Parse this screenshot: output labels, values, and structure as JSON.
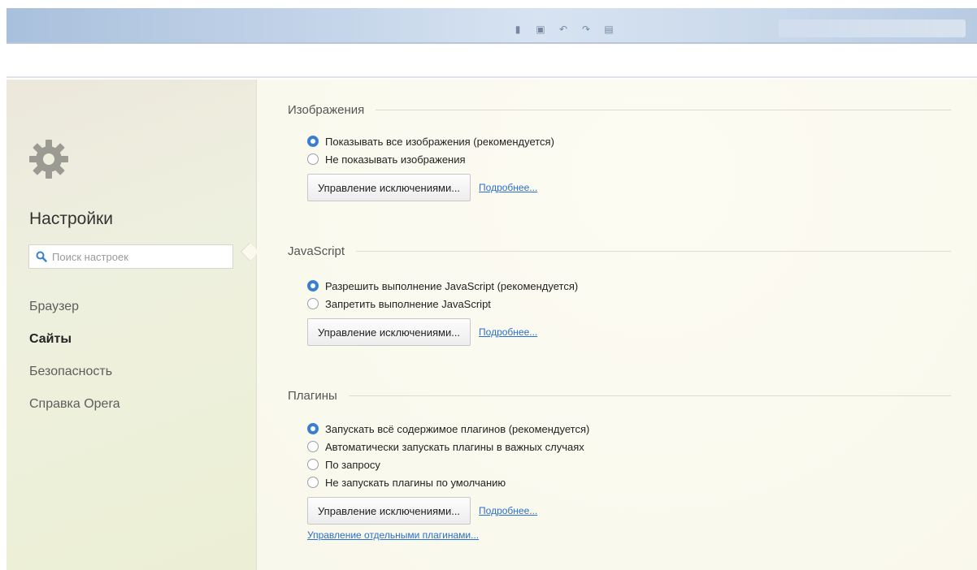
{
  "window": {
    "toolbar_icons": [
      "save-icon",
      "disk-icon",
      "undo-icon",
      "redo-icon",
      "print-icon"
    ]
  },
  "sidebar": {
    "title": "Настройки",
    "search_placeholder": "Поиск настроек",
    "items": [
      {
        "label": "Браузер",
        "active": false
      },
      {
        "label": "Сайты",
        "active": true
      },
      {
        "label": "Безопасность",
        "active": false
      },
      {
        "label": "Справка Opera",
        "active": false
      }
    ]
  },
  "sections": {
    "images": {
      "title": "Изображения",
      "options": [
        {
          "label": "Показывать все изображения (рекомендуется)",
          "checked": true
        },
        {
          "label": "Не показывать изображения",
          "checked": false
        }
      ],
      "manage_button": "Управление исключениями...",
      "more_link": "Подробнее..."
    },
    "javascript": {
      "title": "JavaScript",
      "options": [
        {
          "label": "Разрешить выполнение JavaScript (рекомендуется)",
          "checked": true
        },
        {
          "label": "Запретить выполнение JavaScript",
          "checked": false
        }
      ],
      "manage_button": "Управление исключениями...",
      "more_link": "Подробнее..."
    },
    "plugins": {
      "title": "Плагины",
      "options": [
        {
          "label": "Запускать всё содержимое плагинов (рекомендуется)",
          "checked": true
        },
        {
          "label": "Автоматически запускать плагины в важных случаях",
          "checked": false
        },
        {
          "label": "По запросу",
          "checked": false
        },
        {
          "label": "Не запускать плагины по умолчанию",
          "checked": false
        }
      ],
      "manage_button": "Управление исключениями...",
      "more_link": "Подробнее...",
      "manage_plugins_link": "Управление отдельными плагинами..."
    }
  },
  "colors": {
    "accent": "#3b7fd0",
    "link": "#2a6fc9"
  }
}
